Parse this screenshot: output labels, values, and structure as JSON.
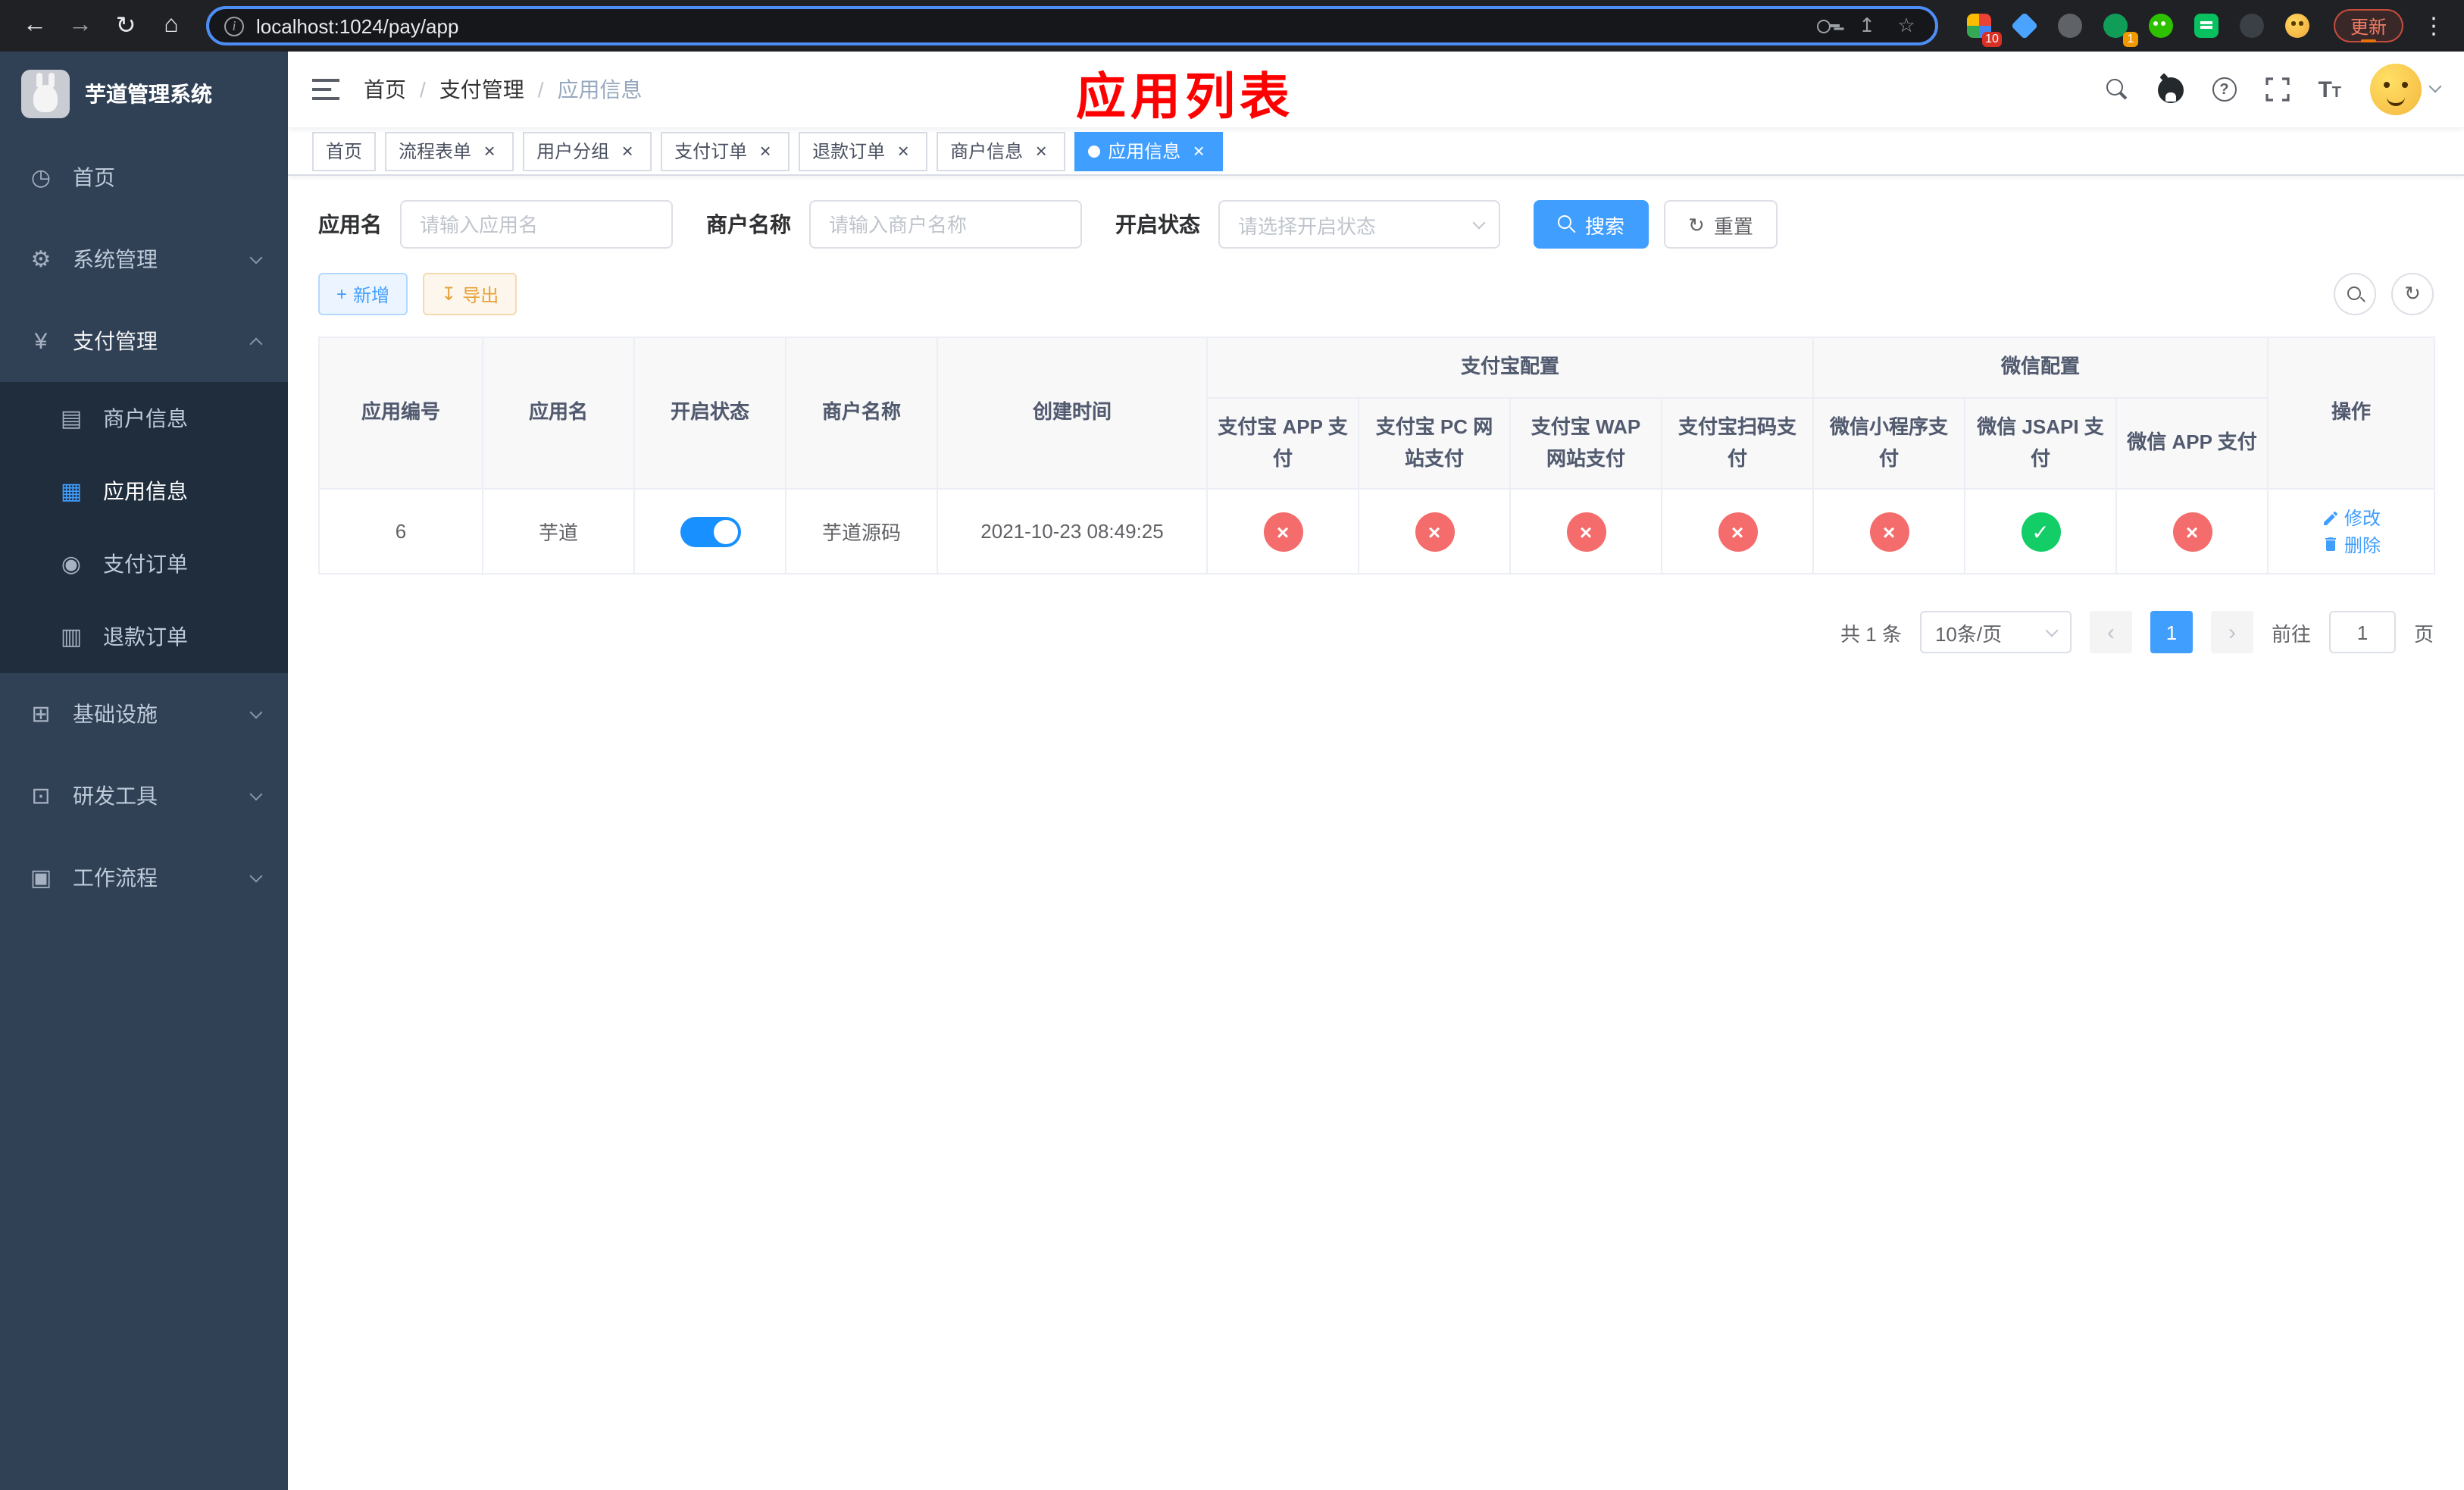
{
  "icons": {
    "back": "←",
    "forward": "→",
    "reload": "↻",
    "home": "⌂",
    "info": "i",
    "share": "↥",
    "star": "☆",
    "dots": "⋮",
    "dashboard": "◷",
    "gear": "⚙",
    "yen": "¥",
    "merchant": "▤",
    "app_grid": "▦",
    "order": "◉",
    "refund": "▥",
    "infra": "⊞",
    "tools": "⊡",
    "workflow": "▣",
    "question": "?",
    "plus": "+",
    "download": "↧",
    "reset": "↻",
    "refresh": "↻",
    "close": "×",
    "check": "✓",
    "cross": "×",
    "prev": "‹",
    "next": "›"
  },
  "browser": {
    "url": "localhost:1024/pay/app",
    "update_label": "更新",
    "ext_badge_1": "10",
    "ext_badge_2": "1"
  },
  "sidebar": {
    "title": "芋道管理系统",
    "home": "首页",
    "system": "系统管理",
    "payment": "支付管理",
    "merchant_info": "商户信息",
    "app_info": "应用信息",
    "pay_order": "支付订单",
    "refund_order": "退款订单",
    "infra": "基础设施",
    "devtools": "研发工具",
    "workflow": "工作流程"
  },
  "header": {
    "breadcrumb": [
      "首页",
      "支付管理",
      "应用信息"
    ],
    "separator": "/",
    "annotation": "应用列表"
  },
  "tabs": [
    {
      "label": "首页"
    },
    {
      "label": "流程表单"
    },
    {
      "label": "用户分组"
    },
    {
      "label": "支付订单"
    },
    {
      "label": "退款订单"
    },
    {
      "label": "商户信息"
    },
    {
      "label": "应用信息"
    }
  ],
  "filters": {
    "app_name_label": "应用名",
    "app_name_placeholder": "请输入应用名",
    "merchant_label": "商户名称",
    "merchant_placeholder": "请输入商户名称",
    "status_label": "开启状态",
    "status_placeholder": "请选择开启状态",
    "search_label": "搜索",
    "reset_label": "重置"
  },
  "toolbar": {
    "add": "新增",
    "export": "导出"
  },
  "table": {
    "headers": {
      "app_id": "应用编号",
      "app_name": "应用名",
      "status": "开启状态",
      "merchant": "商户名称",
      "created": "创建时间",
      "alipay_group": "支付宝配置",
      "wechat_group": "微信配置",
      "alipay_app": "支付宝 APP 支付",
      "alipay_pc": "支付宝 PC 网站支付",
      "alipay_wap": "支付宝 WAP 网站支付",
      "alipay_scan": "支付宝扫码支付",
      "wechat_mini": "微信小程序支付",
      "wechat_jsapi": "微信 JSAPI 支付",
      "wechat_app": "微信 APP 支付",
      "actions": "操作"
    },
    "row": {
      "id": "6",
      "name": "芋道",
      "enabled": true,
      "merchant": "芋道源码",
      "created": "2021-10-23 08:49:25",
      "statuses": [
        false,
        false,
        false,
        false,
        false,
        true,
        false
      ],
      "edit": "修改",
      "delete": "删除"
    }
  },
  "pagination": {
    "total": "共 1 条",
    "page_size": "10条/页",
    "page": "1",
    "goto_label": "前往",
    "goto_value": "1",
    "unit_label": "页"
  }
}
